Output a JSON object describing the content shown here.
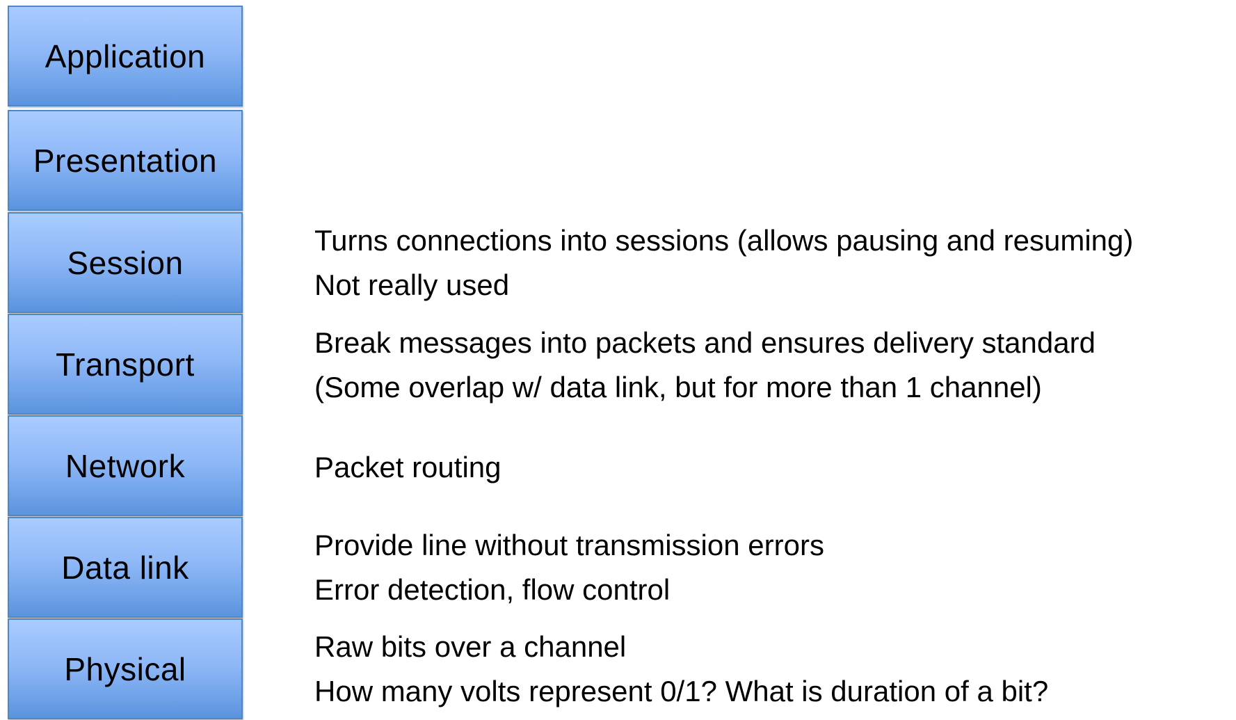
{
  "layers": [
    {
      "name": "Application"
    },
    {
      "name": "Presentation"
    },
    {
      "name": "Session"
    },
    {
      "name": "Transport"
    },
    {
      "name": "Network"
    },
    {
      "name": "Data link"
    },
    {
      "name": "Physical"
    }
  ],
  "descriptions": {
    "session": [
      "Turns connections into sessions (allows pausing and resuming)",
      "Not really used"
    ],
    "transport": [
      "Break messages into packets and ensures delivery standard",
      "(Some overlap w/ data link, but for more than 1 channel)"
    ],
    "network": [
      "Packet routing"
    ],
    "data_link": [
      "Provide line without transmission errors",
      "Error detection, flow control"
    ],
    "physical": [
      "Raw bits over a channel",
      "How many volts represent 0/1?  What is duration of a bit?"
    ]
  },
  "colors": {
    "box_top": "#a9ccff",
    "box_bottom": "#5b93dd",
    "box_border": "#4f86c6"
  }
}
